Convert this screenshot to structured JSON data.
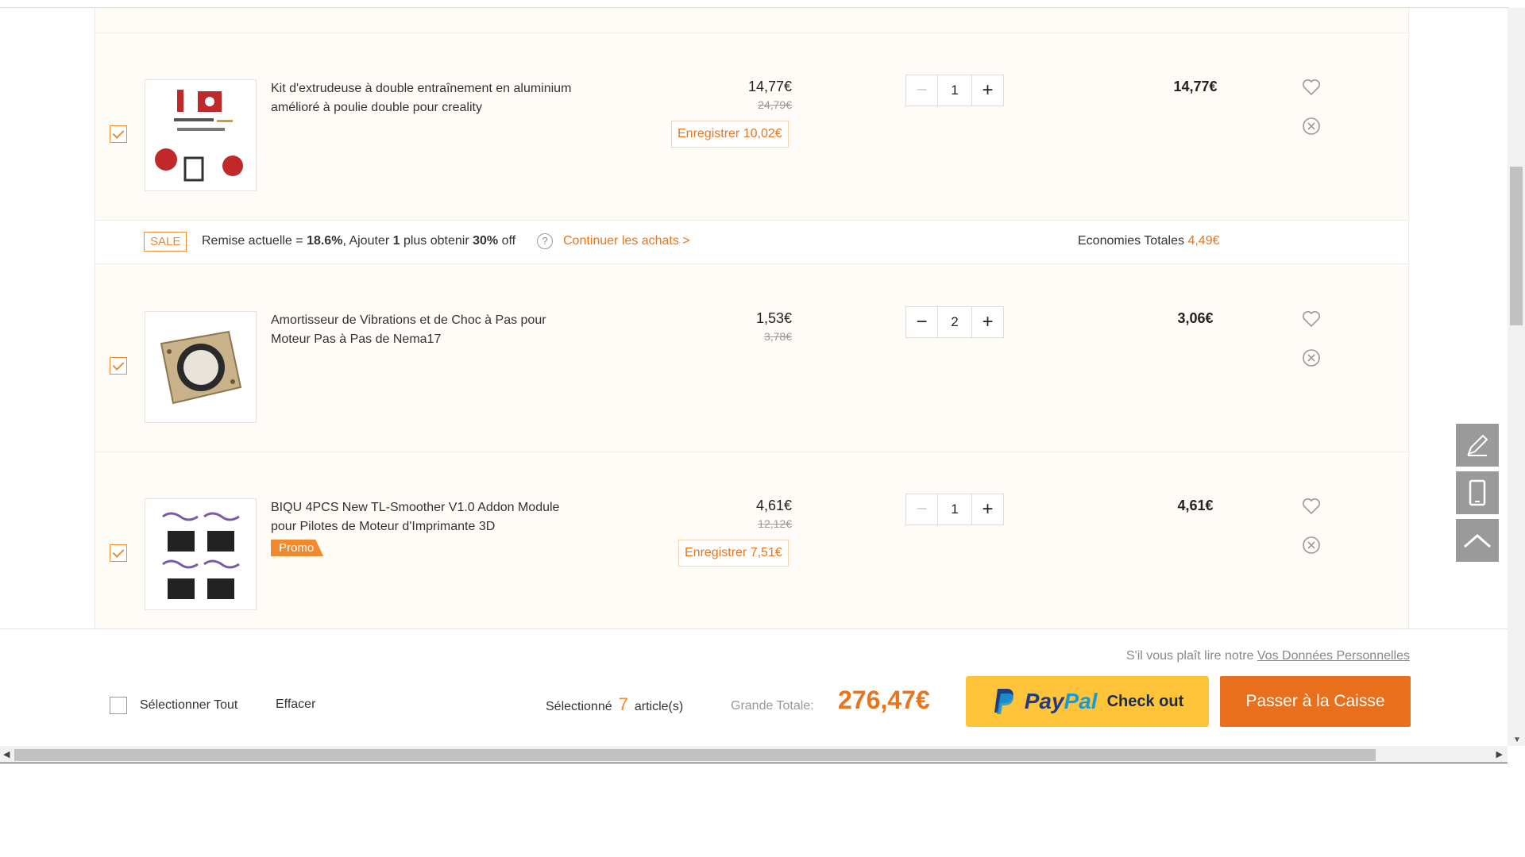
{
  "items": [
    {
      "title": "Kit d'extrudeuse à double entraînement en aluminium amélioré à poulie double pour creality",
      "price": "14,77€",
      "original_price": "24,79€",
      "save_label": "Enregistrer 10,02€",
      "quantity": "1",
      "subtotal": "14,77€",
      "checked": true
    },
    {
      "title": "Amortisseur de Vibrations et de Choc à Pas pour Moteur Pas à Pas de Nema17",
      "price": "1,53€",
      "original_price": "3,78€",
      "quantity": "2",
      "subtotal": "3,06€",
      "checked": true
    },
    {
      "title": "BIQU 4PCS New TL-Smoother V1.0 Addon Module pour Pilotes de Moteur d'Imprimante 3D",
      "price": "4,61€",
      "original_price": "12,12€",
      "save_label": "Enregistrer 7,51€",
      "promo_label": "Promo",
      "quantity": "1",
      "subtotal": "4,61€",
      "checked": true
    }
  ],
  "sale_bar": {
    "badge": "SALE",
    "text_1": "Remise actuelle = ",
    "discount": "18.6%",
    "text_2": ", Ajouter ",
    "add_count": "1",
    "text_3": " plus obtenir ",
    "next_discount": "30%",
    "text_4": " off",
    "help": "?",
    "continue_link": "Continuer les achats >",
    "economies_label": "Economies Totales ",
    "economies_amount": "4,49€"
  },
  "footer": {
    "privacy_text": "S'il vous plaît lire notre ",
    "privacy_link": "Vos Données Personnelles",
    "select_all": "Sélectionner Tout",
    "clear": "Effacer",
    "selected_label": "Sélectionné",
    "selected_count": "7",
    "selected_suffix": "article(s)",
    "grand_total_label": "Grande Totale:",
    "grand_total": "276,47€",
    "paypal_pay": "Pay",
    "paypal_pal": "Pal",
    "paypal_checkout": "Check out",
    "checkout_button": "Passer à la Caisse"
  },
  "colors": {
    "accent": "#e8741c",
    "paypal_yellow": "#ffc439",
    "panel_bg": "#fffcf8"
  },
  "icons": [
    "heart-icon",
    "remove-icon",
    "edit-icon",
    "mobile-icon",
    "back-to-top-icon"
  ]
}
